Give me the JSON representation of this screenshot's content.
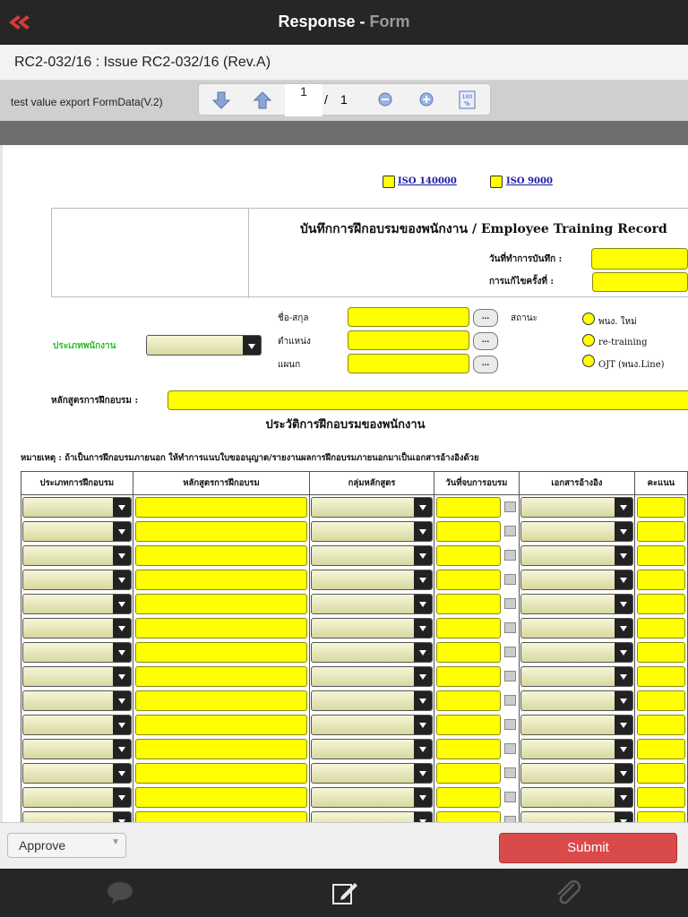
{
  "header": {
    "title_main": "Response - ",
    "title_sub": "Form",
    "back_icon": "back-double-chevron-icon",
    "accent": "#c0392b"
  },
  "document": {
    "ref": "RC2-032/16 : Issue RC2-032/16 (Rev.A)"
  },
  "toolbar": {
    "form_name": "test value export FormData(V.2)",
    "page_current": "1",
    "page_separator": "/",
    "page_total": "1",
    "icons": [
      "arrow-down-icon",
      "arrow-up-icon",
      "zoom-out-icon",
      "zoom-in-icon",
      "zoom-100-icon"
    ]
  },
  "form": {
    "iso1": "ISO 140000",
    "iso2": "ISO 9000",
    "title": "บันทึกการฝึกอบรมของพนักงาน / Employee Training Record",
    "record_date_label": "วันที่ทำการบันทึก :",
    "revision_label": "การแก้ไขครั้งที่ :",
    "employee_type_label": "ประเภทพนักงาน",
    "name_label": "ชื่อ-สกุล",
    "position_label": "ตำแหน่ง",
    "department_label": "แผนก",
    "lookup_button": "...",
    "status_label": "สถานะ",
    "status_options": [
      "พนง. ใหม่",
      "re-training",
      "OJT (พนง.Line)"
    ],
    "course_label": "หลักสูตรการฝึกอบรม :",
    "history_title": "ประวัติการฝึกอบรมของพนักงาน",
    "note": "หมายเหตุ : ถ้าเป็นการฝึกอบรมภายนอก ให้ทำการแนบใบขออนุญาต/รายงานผลการฝึกอบรมภายนอกมาเป็นเอกสารอ้างอิงด้วย",
    "columns": [
      "ประเภทการฝึกอบรม",
      "หลักสูตรการฝึกอบรม",
      "กลุ่มหลักสูตร",
      "วันที่จบการอบรม",
      "เอกสารอ้างอิง",
      "คะแนน"
    ]
  },
  "actions": {
    "approve_label": "Approve",
    "submit_label": "Submit",
    "submit_color": "#d94a4a"
  },
  "nav": {
    "icons": [
      "comment-icon",
      "edit-form-icon",
      "attachment-icon"
    ]
  }
}
